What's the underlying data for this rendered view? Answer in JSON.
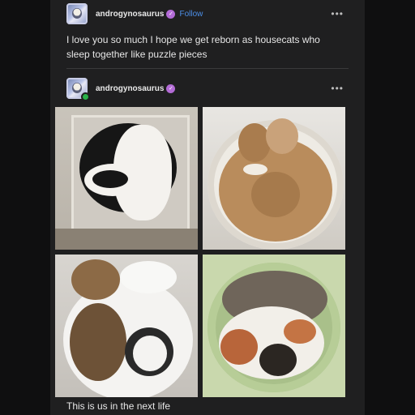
{
  "post1": {
    "username": "androgynosaurus",
    "follow_label": "Follow",
    "more_icon": "more-options-icon",
    "text": "I love you so much I hope we get reborn as housecats who sleep together like puzzle pieces"
  },
  "post2": {
    "username": "androgynosaurus",
    "more_icon": "more-options-icon",
    "caption": "This is us in the next life"
  },
  "colors": {
    "background": "#0f0f10",
    "card": "#1f1f20",
    "follow_link": "#4c8fe8",
    "verified_badge": "#b36bd6",
    "online_badge": "#2ab24a"
  }
}
